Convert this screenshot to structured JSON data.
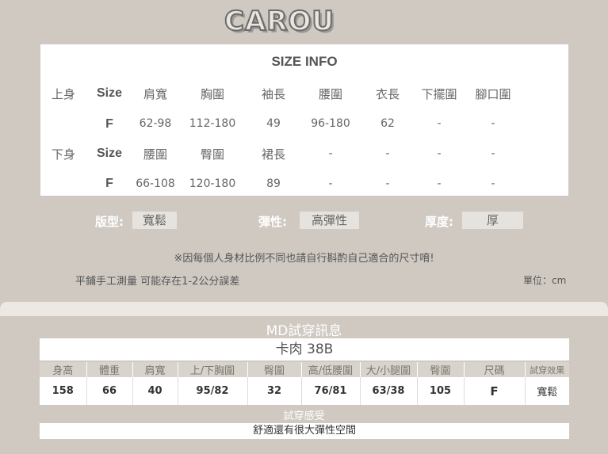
{
  "brand": "CAROU",
  "size_info": {
    "title": "SIZE INFO",
    "upper": {
      "section": "上身",
      "size_label": "Size",
      "headers": [
        "肩寬",
        "胸圍",
        "袖長",
        "腰圍",
        "衣長",
        "下擺圍",
        "腳口圍"
      ],
      "size": "F",
      "values": [
        "62-98",
        "112-180",
        "49",
        "96-180",
        "62",
        "-",
        "-"
      ]
    },
    "lower": {
      "section": "下身",
      "size_label": "Size",
      "headers": [
        "腰圍",
        "臀圍",
        "裙長",
        "-",
        "-",
        "-",
        "-"
      ],
      "size": "F",
      "values": [
        "66-108",
        "120-180",
        "89",
        "-",
        "-",
        "-",
        "-"
      ]
    }
  },
  "attributes": {
    "fit_label": "版型:",
    "fit_value": "寬鬆",
    "elastic_label": "彈性:",
    "elastic_value": "高彈性",
    "thickness_label": "厚度:",
    "thickness_value": "厚"
  },
  "notes": {
    "disclaimer": "※因每個人身材比例不同也請自行斟酌自己適合的尺寸唷!",
    "measure": "平鋪手工測量 可能存在1-2公分誤差",
    "unit": "單位：cm"
  },
  "md": {
    "title": "MD試穿訊息",
    "model": "卡肉 38B",
    "headers": [
      "身高",
      "體重",
      "肩寬",
      "上/下胸圍",
      "臀圍",
      "高/低腰圍",
      "大/小腿圍",
      "臀圍",
      "尺碼",
      "試穿效果"
    ],
    "values": [
      "158",
      "66",
      "40",
      "95/82",
      "32",
      "76/81",
      "63/38",
      "105",
      "F",
      "寬鬆"
    ],
    "feel_label": "試穿感受",
    "feel_value": "舒適還有很大彈性空間"
  }
}
